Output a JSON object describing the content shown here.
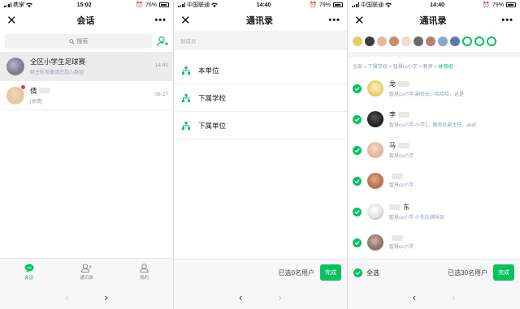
{
  "screen1": {
    "status": {
      "carrier": "携掌",
      "time": "15:02",
      "battery": "76%",
      "battery_level": 0.76
    },
    "title": "会话",
    "search_placeholder": "搜索",
    "chats": [
      {
        "name": "全区小学生足球赛",
        "preview": "群主陈莹邀请您加入群组",
        "time": "14:41"
      },
      {
        "name": "倩",
        "preview": "[表情]",
        "time": "06-27"
      }
    ],
    "tabs": [
      {
        "label": "会话",
        "icon": "chat-icon"
      },
      {
        "label": "通讯录",
        "icon": "contacts-icon"
      },
      {
        "label": "我的",
        "icon": "profile-icon"
      }
    ],
    "nav": {
      "back": "‹",
      "forward": "›"
    }
  },
  "screen2": {
    "status": {
      "carrier": "中国联通",
      "time": "14:40",
      "battery": "79%",
      "battery_level": 0.79
    },
    "title": "通讯录",
    "selected_label": "群成员",
    "org_items": [
      "本单位",
      "下属学校",
      "下属单位"
    ],
    "selected_count": "已选0名用户",
    "done": "完成"
  },
  "screen3": {
    "status": {
      "carrier": "中国联通",
      "time": "14:40",
      "battery": "79%",
      "battery_level": 0.79
    },
    "title": "通讯录",
    "breadcrumb": [
      "全部",
      "下属学校",
      "智慧cs小学",
      "教师",
      "体育组"
    ],
    "members": [
      {
        "name": "龙",
        "desc": "智慧cs小学-副校长，哈哈哈，这是"
      },
      {
        "name": "李",
        "desc": "智慧cs小学-小学1，教务处副主任，asdf"
      },
      {
        "name": "马",
        "desc": "智慧cs小学"
      },
      {
        "name": "",
        "desc": "智慧cs小学"
      },
      {
        "name": "东",
        "desc": "智慧cs小学-少先队辅导员"
      },
      {
        "name": "",
        "desc": "智慧cs小学"
      }
    ],
    "select_all": "全选",
    "selected_count": "已选30名用户",
    "done": "完成"
  },
  "colors": {
    "accent": "#07c160",
    "link": "#8a9bb8",
    "unread": "#f43530"
  }
}
